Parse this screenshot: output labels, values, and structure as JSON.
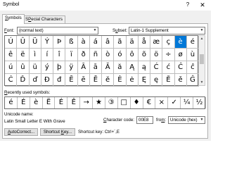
{
  "window": {
    "title": "Symbol",
    "help_glyph": "?",
    "close_glyph": "✕"
  },
  "tabs": [
    {
      "label": "Symbols",
      "accel": "S",
      "rest": "ymbols",
      "active": true
    },
    {
      "label": "Special Characters",
      "accel": "P",
      "pre": "S",
      "rest": "ecial Characters",
      "active": false
    }
  ],
  "font": {
    "label": "Font:",
    "accel": "F",
    "rest": "ont:",
    "value": "(normal text)"
  },
  "subset": {
    "label": "Subset:",
    "pre": "S",
    "accel": "u",
    "rest": "bset:",
    "value": "Latin-1 Supplement"
  },
  "symbol_grid": {
    "rows": [
      [
        "Ú",
        "Û",
        "Ü",
        "Ý",
        "Þ",
        "ß",
        "à",
        "á",
        "â",
        "ã",
        "ä",
        "å",
        "æ",
        "ç",
        "è",
        "é"
      ],
      [
        "ê",
        "ë",
        "ì",
        "í",
        "î",
        "ï",
        "ð",
        "ñ",
        "ò",
        "ó",
        "ô",
        "õ",
        "ö",
        "÷",
        "ø",
        "ù"
      ],
      [
        "ú",
        "û",
        "ü",
        "ý",
        "þ",
        "ÿ",
        "Ā",
        "ā",
        "Ă",
        "ă",
        "Ą",
        "ą",
        "Ć",
        "ć",
        "Ĉ",
        "ĉ"
      ],
      [
        "Ċ",
        "Ď",
        "ď",
        "Đ",
        "đ",
        "Ē",
        "ē",
        "Ĕ",
        "ĕ",
        "Ė",
        "ė",
        "Ę",
        "ę",
        "Ě",
        "ě",
        "Ĝ"
      ]
    ],
    "selected": {
      "row": 0,
      "col": 14
    }
  },
  "scrollbar": {
    "up_glyph": "▲",
    "down_glyph": "▼"
  },
  "recent": {
    "label": "Recently used symbols:",
    "accel": "R",
    "rest": "ecently used symbols:",
    "symbols": [
      "é",
      "É",
      "è",
      "Ë",
      "É",
      "Ê",
      "→",
      "★",
      "③",
      "□",
      "♦",
      "€",
      "×",
      "✓",
      "¼",
      "½"
    ]
  },
  "unicode_name": {
    "label": "Unicode name:",
    "value": "Latin Small Letter E With Grave"
  },
  "character_code": {
    "label": "Character code:",
    "accel": "C",
    "rest": "haracter code:",
    "value": "00E8"
  },
  "from": {
    "label": "from:",
    "pre": "fro",
    "accel": "m",
    "rest": ":",
    "value": "Unicode (hex)"
  },
  "buttons": {
    "autocorrect": {
      "label": "AutoCorrect...",
      "accel": "A",
      "rest": "utoCorrect..."
    },
    "shortcut_key": {
      "label": "Shortcut Key...",
      "pre": "Shortcut ",
      "accel": "K",
      "rest": "ey..."
    }
  },
  "shortcut_key_text": "Shortcut key: Ctrl+`,E",
  "colors": {
    "selection": "#0078d7",
    "dialog_bg": "#f0f0f0"
  }
}
